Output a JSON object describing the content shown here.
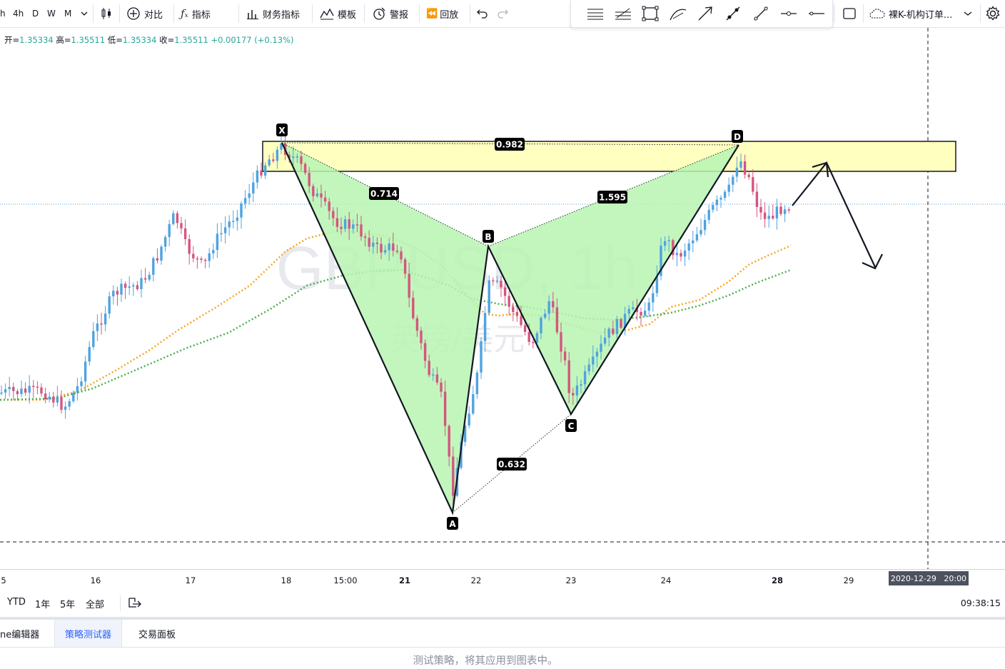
{
  "toolbar": {
    "timeframes": [
      "h",
      "4h",
      "D",
      "W",
      "M"
    ],
    "compare_label": "对比",
    "indicators_label": "指标",
    "financials_label": "财务指标",
    "templates_label": "模板",
    "alert_label": "警报",
    "replay_label": "回放",
    "layout_label": "裸K-机构订单..."
  },
  "ohlc": {
    "open_label": "开=",
    "open": "1.35334",
    "high_label": "高=",
    "high": "1.35511",
    "low_label": "低=",
    "low": "1.35334",
    "close_label": "收=",
    "close": "1.35511",
    "change": "+0.00177 (+0.13%)"
  },
  "watermark": {
    "symbol": "GBPUSD, 1h",
    "name": "英镑/美元"
  },
  "pattern": {
    "points": [
      "X",
      "A",
      "B",
      "C",
      "D"
    ],
    "ratios": {
      "xb": "0.714",
      "xd": "0.982",
      "ac": "0.632",
      "bd": "1.595"
    }
  },
  "time_axis": {
    "labels": [
      "5",
      "16",
      "17",
      "18",
      "15:00",
      "21",
      "22",
      "23",
      "24",
      "28",
      "29"
    ],
    "bold_labels": [
      "21",
      "28"
    ],
    "crosshair_date": "2020-12-29",
    "crosshair_time": "20:00"
  },
  "range_bar": {
    "ranges": [
      "YTD",
      "1年",
      "5年",
      "全部"
    ],
    "clock": "09:38:15"
  },
  "panel": {
    "tabs": [
      "ne编辑器",
      "策略测试器",
      "交易面板"
    ],
    "active_tab": "策略测试器",
    "placeholder": "测试策略，将其应用到图表中。"
  },
  "colors": {
    "up": "#26a69a",
    "down": "#ef5350",
    "up_candle": "#4fa3e0",
    "down_candle": "#d4567f",
    "pattern_fill": "#b7f5b2",
    "zone_fill": "#ffffc0",
    "ma_fast": "#f5a623",
    "ma_slow": "#4caf50"
  }
}
